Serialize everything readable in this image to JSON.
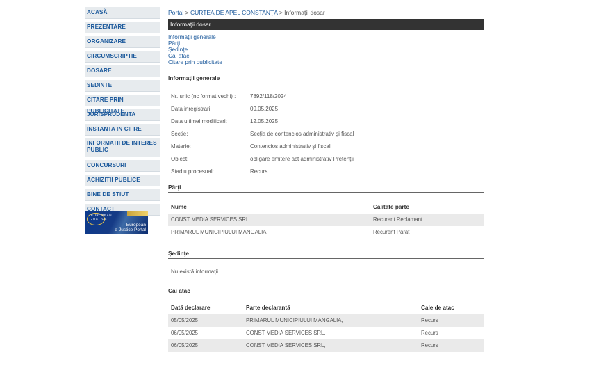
{
  "sidebar": {
    "items": [
      {
        "label": "ACASĂ"
      },
      {
        "label": "PREZENTARE"
      },
      {
        "label": "ORGANIZARE"
      },
      {
        "label": "CIRCUMSCRIPTIE"
      },
      {
        "label": "DOSARE"
      },
      {
        "label": "SEDINTE"
      },
      {
        "label": "CITARE PRIN PUBLICITATE"
      },
      {
        "label": "JURISPRUDENTA"
      },
      {
        "label": "INSTANTA IN CIFRE"
      },
      {
        "label": "INFORMATII DE INTERES PUBLIC"
      },
      {
        "label": "CONCURSURI"
      },
      {
        "label": "ACHIZITII PUBLICE"
      },
      {
        "label": "BINE DE STIUT"
      },
      {
        "label": "CONTACT"
      }
    ],
    "logo": {
      "line1": "EUROPEAN",
      "line2": "JUSTICE",
      "caption1": "European",
      "caption2": "e-Justice Portal"
    }
  },
  "breadcrumb": {
    "home": "Portal",
    "sep1": ">",
    "court": "CURTEA DE APEL CONSTANŢA",
    "sep2": ">",
    "current": "Informaţii dosar"
  },
  "title_bar": "Informaţii dosar",
  "quicklinks": [
    "Informaţii generale",
    "Părţi",
    "Şedinţe",
    "Căi atac",
    "Citare prin publicitate"
  ],
  "general": {
    "heading": "Informaţii generale",
    "rows": [
      {
        "k": "Nr. unic (nc format vechi) :",
        "v": "7892/118/2024"
      },
      {
        "k": "Data inregistrarii",
        "v": "09.05.2025"
      },
      {
        "k": "Data ultimei modificari:",
        "v": "12.05.2025"
      },
      {
        "k": "Sectie:",
        "v": "Secţia de contencios administrativ şi fiscal"
      },
      {
        "k": "Materie:",
        "v": "Contencios administrativ şi fiscal"
      },
      {
        "k": "Obiect:",
        "v": "obligare emitere act administrativ Pretenţii"
      },
      {
        "k": "Stadiu procesual:",
        "v": "Recurs"
      }
    ]
  },
  "parti": {
    "heading": "Părţi",
    "col_name": "Nume",
    "col_role": "Calitate parte",
    "rows": [
      {
        "name": "CONST MEDIA SERVICES SRL",
        "role": "Recurent Reclamant"
      },
      {
        "name": "PRIMARUL MUNICIPIULUI MANGALIA",
        "role": "Recurent Pârât"
      }
    ]
  },
  "sedinte": {
    "heading": "Şedinţe",
    "empty": "Nu există informaţii."
  },
  "cai_atac": {
    "heading": "Căi atac",
    "col_date": "Dată declarare",
    "col_party": "Parte declarantă",
    "col_type": "Cale de atac",
    "rows": [
      {
        "date": "05/05/2025",
        "party": "PRIMARUL MUNICIPIULUI MANGALIA,",
        "type": "Recurs"
      },
      {
        "date": "06/05/2025",
        "party": "CONST MEDIA SERVICES SRL,",
        "type": "Recurs"
      },
      {
        "date": "06/05/2025",
        "party": "CONST MEDIA SERVICES SRL,",
        "type": "Recurs"
      }
    ]
  }
}
